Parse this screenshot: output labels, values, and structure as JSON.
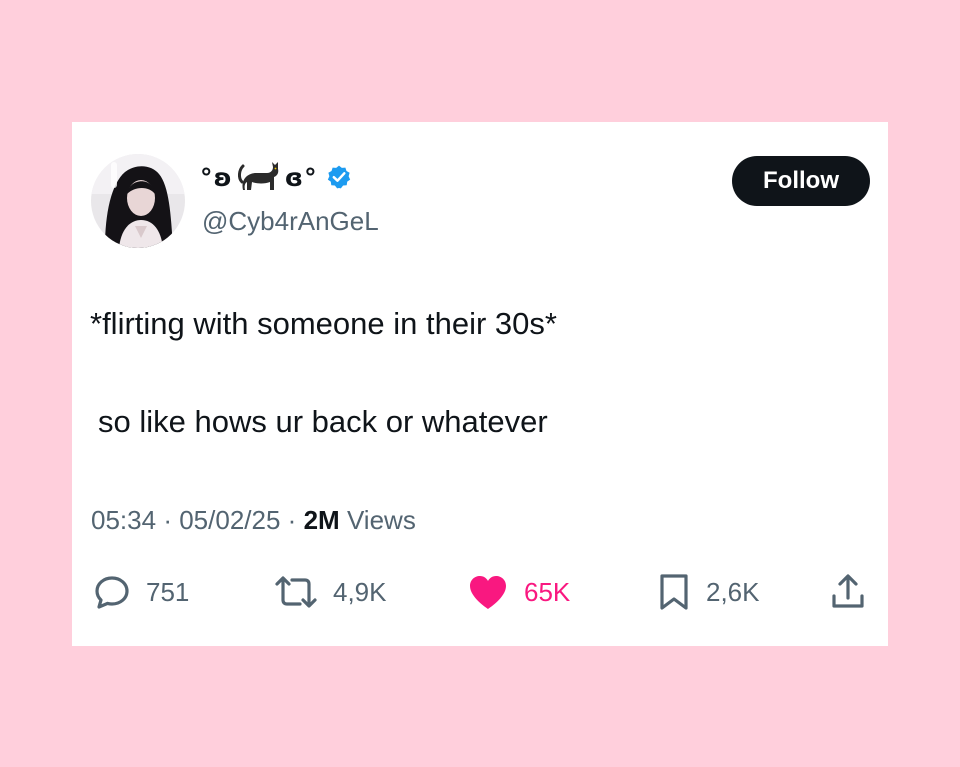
{
  "tweet": {
    "display_name_left": "°ʚ",
    "display_name_right": "ɞ°",
    "handle": "@Cyb4rAnGeL",
    "follow_label": "Follow",
    "text_line_1": "*flirting with someone in their 30s*",
    "text_line_2": "so like hows ur back or whatever",
    "time": "05:34",
    "date": "05/02/25",
    "separator": "·",
    "views_count": "2M",
    "views_label": "Views"
  },
  "actions": {
    "replies": "751",
    "retweets": "4,9K",
    "likes": "65K",
    "bookmarks": "2,6K"
  },
  "icons": {
    "avatar": "profile-photo",
    "cat": "black-cat-emoji",
    "verified": "verified-badge",
    "reply": "reply-icon",
    "retweet": "retweet-icon",
    "like": "heart-icon",
    "bookmark": "bookmark-icon",
    "share": "share-icon"
  },
  "colors": {
    "background": "#ffcfdc",
    "card": "#ffffff",
    "text": "#0f1419",
    "secondary_text": "#536471",
    "like": "#f91880",
    "verified": "#1d9bf0",
    "follow_button": "#0f1419"
  }
}
